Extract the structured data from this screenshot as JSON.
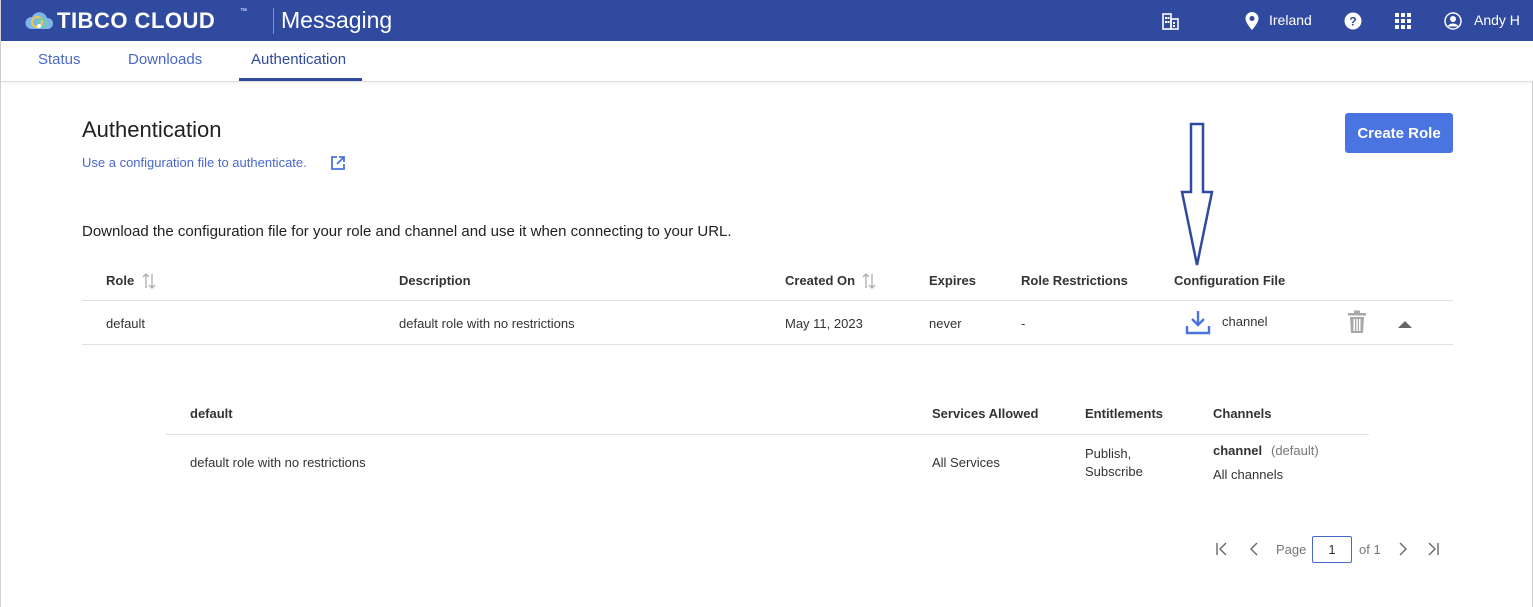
{
  "header": {
    "brand": "TIBCO CLOUD",
    "trademark": "™",
    "product": "Messaging",
    "region": "Ireland",
    "user": "Andy H"
  },
  "tabs": [
    {
      "label": "Status"
    },
    {
      "label": "Downloads"
    },
    {
      "label": "Authentication"
    }
  ],
  "page": {
    "title": "Authentication",
    "config_link": "Use a configuration file to authenticate.",
    "create_button": "Create Role",
    "intro": "Download the configuration file for your role and channel and use it when connecting to your URL."
  },
  "table": {
    "columns": [
      "Role",
      "Description",
      "Created On",
      "Expires",
      "Role Restrictions",
      "Configuration File"
    ],
    "rows": [
      {
        "role": "default",
        "description": "default role with no restrictions",
        "created_on": "May 11, 2023",
        "expires": "never",
        "restrictions": "-",
        "config_file": "channel"
      }
    ]
  },
  "details": {
    "columns": [
      "default",
      "Services Allowed",
      "Entitlements",
      "Channels"
    ],
    "description": "default role with no restrictions",
    "services": "All Services",
    "entitlements_line1": "Publish,",
    "entitlements_line2": "Subscribe",
    "channel_name": "channel",
    "channel_tag": "(default)",
    "channel_scope": "All channels"
  },
  "pagination": {
    "page_label": "Page",
    "current_page": "1",
    "of_label": "of 1"
  },
  "colors": {
    "header_bg": "#2f4a9e",
    "accent": "#4a74e0",
    "link": "#4a68c8"
  }
}
